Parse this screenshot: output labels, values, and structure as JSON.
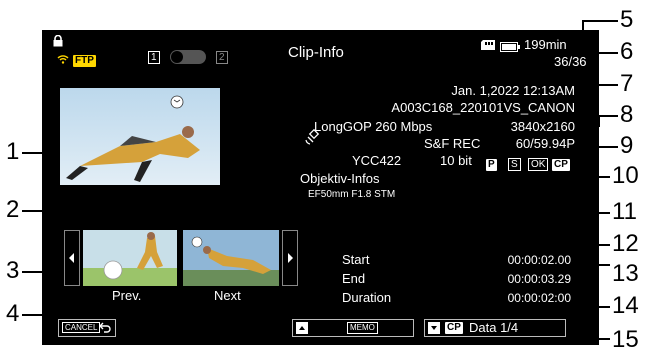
{
  "header": {
    "title": "Clip-Info",
    "ftp_badge": "FTP",
    "slot1": "1",
    "slot2": "2",
    "media_remaining": "199min",
    "clip_counter": "36/36"
  },
  "clip": {
    "datetime": "Jan. 1,2022 12:13AM",
    "clip_name": "A003C168_220101VS_CANON",
    "codec": "LongGOP 260 Mbps",
    "resolution": "3840x2160",
    "rec_mode": "S&F REC",
    "frame_rate": "60/59.94P",
    "color_sampling": "YCC422",
    "bit_depth": "10 bit",
    "mark_p": "P",
    "mark_s": "S",
    "mark_ok": "OK",
    "mark_cp": "CP",
    "lens_info_label": "Objektiv-Infos",
    "lens_info_value": "EF50mm F1.8 STM"
  },
  "navigation": {
    "prev_label": "Prev.",
    "next_label": "Next"
  },
  "timecodes": {
    "start_label": "Start",
    "start_value": "00:00:02.00",
    "end_label": "End",
    "end_value": "00:00:03.29",
    "duration_label": "Duration",
    "duration_value": "00:00:02:00"
  },
  "footer": {
    "cancel_label": "CANCEL",
    "memo_label": "MEMO",
    "cp_label": "CP",
    "data_page": "Data 1/4"
  },
  "callouts": [
    "1",
    "2",
    "3",
    "4",
    "5",
    "6",
    "7",
    "8",
    "9",
    "10",
    "11",
    "12",
    "13",
    "14",
    "15"
  ],
  "colors": {
    "screen_bg": "#000000",
    "ftp_badge": "#ffd700",
    "wifi_icon": "#ffd700"
  }
}
